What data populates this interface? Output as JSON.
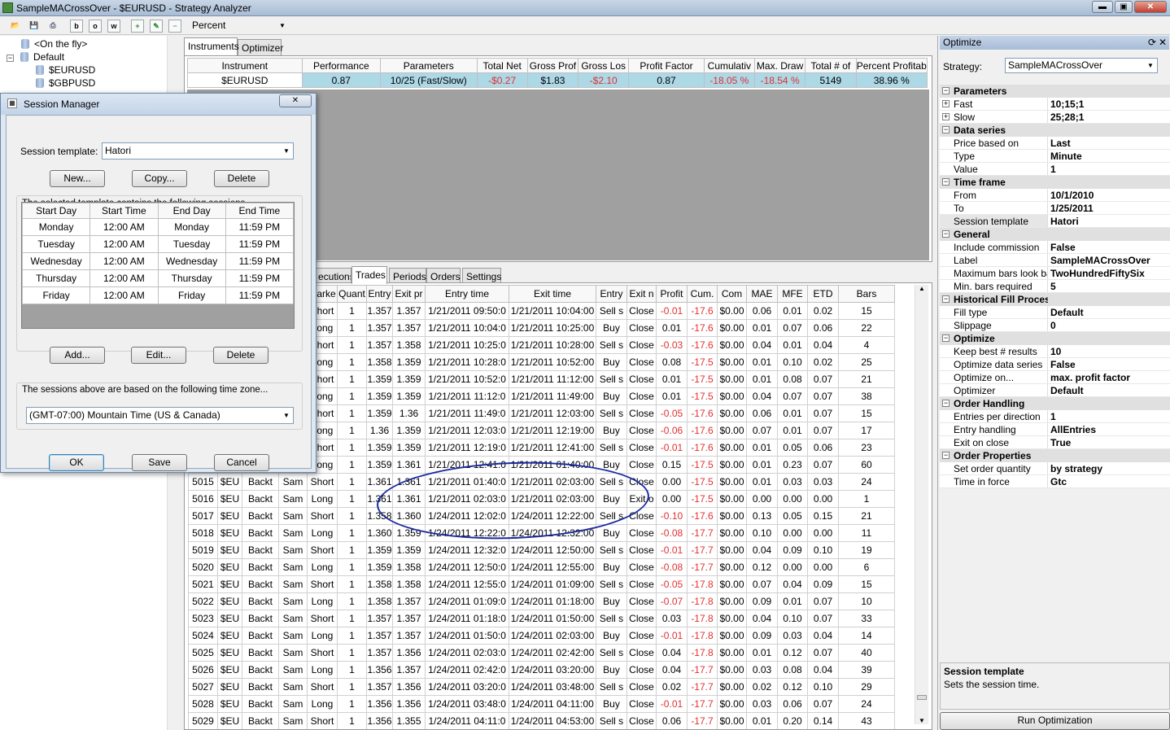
{
  "window": {
    "title": "SampleMACrossOver - $EURUSD - Strategy Analyzer"
  },
  "toolbar": {
    "view_value": "Percent",
    "b1": "b",
    "b2": "o",
    "b3": "w"
  },
  "tree": {
    "items": [
      "<On the fly>",
      "Default",
      "$EURUSD",
      "$GBPUSD"
    ]
  },
  "top_tabs": [
    "Instruments",
    "Optimizer"
  ],
  "instruments": {
    "headers": [
      "Instrument",
      "Performance",
      "Parameters",
      "Total Net",
      "Gross Prof",
      "Gross Los",
      "Profit Factor",
      "Cumulativ",
      "Max. Draw",
      "Total # of",
      "Percent Profitab"
    ],
    "row": [
      "$EURUSD",
      "0.87",
      "10/25 (Fast/Slow)",
      "-$0.27",
      "$1.83",
      "-$2.10",
      "0.87",
      "-18.05 %",
      "-18.54 %",
      "5149",
      "38.96 %"
    ]
  },
  "bottom_tabs": [
    "ecutions",
    "Trades",
    "Periods",
    "Orders",
    "Settings"
  ],
  "trades": {
    "headers": [
      "",
      "",
      "",
      "",
      "Marke",
      "Quant",
      "Entry",
      "Exit pr",
      "Entry time",
      "Exit time",
      "Entry",
      "Exit n",
      "Profit",
      "Cum.",
      "Com",
      "MAE",
      "MFE",
      "ETD",
      "Bars"
    ],
    "rows": [
      [
        "",
        "",
        "",
        "",
        "Short",
        "1",
        "1.357",
        "1.357",
        "1/21/2011 09:50:0",
        "1/21/2011 10:04:00",
        "Sell s",
        "Close",
        "-0.01",
        "-17.6",
        "$0.00",
        "0.06",
        "0.01",
        "0.02",
        "15"
      ],
      [
        "",
        "",
        "",
        "",
        "Long",
        "1",
        "1.357",
        "1.357",
        "1/21/2011 10:04:0",
        "1/21/2011 10:25:00",
        "Buy",
        "Close",
        "0.01",
        "-17.6",
        "$0.00",
        "0.01",
        "0.07",
        "0.06",
        "22"
      ],
      [
        "",
        "",
        "",
        "",
        "Short",
        "1",
        "1.357",
        "1.358",
        "1/21/2011 10:25:0",
        "1/21/2011 10:28:00",
        "Sell s",
        "Close",
        "-0.03",
        "-17.6",
        "$0.00",
        "0.04",
        "0.01",
        "0.04",
        "4"
      ],
      [
        "",
        "",
        "",
        "",
        "Long",
        "1",
        "1.358",
        "1.359",
        "1/21/2011 10:28:0",
        "1/21/2011 10:52:00",
        "Buy",
        "Close",
        "0.08",
        "-17.5",
        "$0.00",
        "0.01",
        "0.10",
        "0.02",
        "25"
      ],
      [
        "",
        "",
        "",
        "",
        "Short",
        "1",
        "1.359",
        "1.359",
        "1/21/2011 10:52:0",
        "1/21/2011 11:12:00",
        "Sell s",
        "Close",
        "0.01",
        "-17.5",
        "$0.00",
        "0.01",
        "0.08",
        "0.07",
        "21"
      ],
      [
        "",
        "",
        "",
        "",
        "Long",
        "1",
        "1.359",
        "1.359",
        "1/21/2011 11:12:0",
        "1/21/2011 11:49:00",
        "Buy",
        "Close",
        "0.01",
        "-17.5",
        "$0.00",
        "0.04",
        "0.07",
        "0.07",
        "38"
      ],
      [
        "",
        "",
        "",
        "",
        "Short",
        "1",
        "1.359",
        "1.36",
        "1/21/2011 11:49:0",
        "1/21/2011 12:03:00",
        "Sell s",
        "Close",
        "-0.05",
        "-17.6",
        "$0.00",
        "0.06",
        "0.01",
        "0.07",
        "15"
      ],
      [
        "",
        "",
        "",
        "",
        "Long",
        "1",
        "1.36",
        "1.359",
        "1/21/2011 12:03:0",
        "1/21/2011 12:19:00",
        "Buy",
        "Close",
        "-0.06",
        "-17.6",
        "$0.00",
        "0.07",
        "0.01",
        "0.07",
        "17"
      ],
      [
        "",
        "",
        "",
        "",
        "Short",
        "1",
        "1.359",
        "1.359",
        "1/21/2011 12:19:0",
        "1/21/2011 12:41:00",
        "Sell s",
        "Close",
        "-0.01",
        "-17.6",
        "$0.00",
        "0.01",
        "0.05",
        "0.06",
        "23"
      ],
      [
        "",
        "",
        "",
        "",
        "Long",
        "1",
        "1.359",
        "1.361",
        "1/21/2011 12:41:0",
        "1/21/2011 01:40:00",
        "Buy",
        "Close",
        "0.15",
        "-17.5",
        "$0.00",
        "0.01",
        "0.23",
        "0.07",
        "60"
      ],
      [
        "5015",
        "$EU",
        "Backt",
        "Sam",
        "Short",
        "1",
        "1.361",
        "1.361",
        "1/21/2011 01:40:0",
        "1/21/2011 02:03:00",
        "Sell s",
        "Close",
        "0.00",
        "-17.5",
        "$0.00",
        "0.01",
        "0.03",
        "0.03",
        "24"
      ],
      [
        "5016",
        "$EU",
        "Backt",
        "Sam",
        "Long",
        "1",
        "1.361",
        "1.361",
        "1/21/2011 02:03:0",
        "1/21/2011 02:03:00",
        "Buy",
        "Exit o",
        "0.00",
        "-17.5",
        "$0.00",
        "0.00",
        "0.00",
        "0.00",
        "1"
      ],
      [
        "5017",
        "$EU",
        "Backt",
        "Sam",
        "Short",
        "1",
        "1.358",
        "1.360",
        "1/24/2011 12:02:0",
        "1/24/2011 12:22:00",
        "Sell s",
        "Close",
        "-0.10",
        "-17.6",
        "$0.00",
        "0.13",
        "0.05",
        "0.15",
        "21"
      ],
      [
        "5018",
        "$EU",
        "Backt",
        "Sam",
        "Long",
        "1",
        "1.360",
        "1.359",
        "1/24/2011 12:22:0",
        "1/24/2011 12:32:00",
        "Buy",
        "Close",
        "-0.08",
        "-17.7",
        "$0.00",
        "0.10",
        "0.00",
        "0.00",
        "11"
      ],
      [
        "5019",
        "$EU",
        "Backt",
        "Sam",
        "Short",
        "1",
        "1.359",
        "1.359",
        "1/24/2011 12:32:0",
        "1/24/2011 12:50:00",
        "Sell s",
        "Close",
        "-0.01",
        "-17.7",
        "$0.00",
        "0.04",
        "0.09",
        "0.10",
        "19"
      ],
      [
        "5020",
        "$EU",
        "Backt",
        "Sam",
        "Long",
        "1",
        "1.359",
        "1.358",
        "1/24/2011 12:50:0",
        "1/24/2011 12:55:00",
        "Buy",
        "Close",
        "-0.08",
        "-17.7",
        "$0.00",
        "0.12",
        "0.00",
        "0.00",
        "6"
      ],
      [
        "5021",
        "$EU",
        "Backt",
        "Sam",
        "Short",
        "1",
        "1.358",
        "1.358",
        "1/24/2011 12:55:0",
        "1/24/2011 01:09:00",
        "Sell s",
        "Close",
        "-0.05",
        "-17.8",
        "$0.00",
        "0.07",
        "0.04",
        "0.09",
        "15"
      ],
      [
        "5022",
        "$EU",
        "Backt",
        "Sam",
        "Long",
        "1",
        "1.358",
        "1.357",
        "1/24/2011 01:09:0",
        "1/24/2011 01:18:00",
        "Buy",
        "Close",
        "-0.07",
        "-17.8",
        "$0.00",
        "0.09",
        "0.01",
        "0.07",
        "10"
      ],
      [
        "5023",
        "$EU",
        "Backt",
        "Sam",
        "Short",
        "1",
        "1.357",
        "1.357",
        "1/24/2011 01:18:0",
        "1/24/2011 01:50:00",
        "Sell s",
        "Close",
        "0.03",
        "-17.8",
        "$0.00",
        "0.04",
        "0.10",
        "0.07",
        "33"
      ],
      [
        "5024",
        "$EU",
        "Backt",
        "Sam",
        "Long",
        "1",
        "1.357",
        "1.357",
        "1/24/2011 01:50:0",
        "1/24/2011 02:03:00",
        "Buy",
        "Close",
        "-0.01",
        "-17.8",
        "$0.00",
        "0.09",
        "0.03",
        "0.04",
        "14"
      ],
      [
        "5025",
        "$EU",
        "Backt",
        "Sam",
        "Short",
        "1",
        "1.357",
        "1.356",
        "1/24/2011 02:03:0",
        "1/24/2011 02:42:00",
        "Sell s",
        "Close",
        "0.04",
        "-17.8",
        "$0.00",
        "0.01",
        "0.12",
        "0.07",
        "40"
      ],
      [
        "5026",
        "$EU",
        "Backt",
        "Sam",
        "Long",
        "1",
        "1.356",
        "1.357",
        "1/24/2011 02:42:0",
        "1/24/2011 03:20:00",
        "Buy",
        "Close",
        "0.04",
        "-17.7",
        "$0.00",
        "0.03",
        "0.08",
        "0.04",
        "39"
      ],
      [
        "5027",
        "$EU",
        "Backt",
        "Sam",
        "Short",
        "1",
        "1.357",
        "1.356",
        "1/24/2011 03:20:0",
        "1/24/2011 03:48:00",
        "Sell s",
        "Close",
        "0.02",
        "-17.7",
        "$0.00",
        "0.02",
        "0.12",
        "0.10",
        "29"
      ],
      [
        "5028",
        "$EU",
        "Backt",
        "Sam",
        "Long",
        "1",
        "1.356",
        "1.356",
        "1/24/2011 03:48:0",
        "1/24/2011 04:11:00",
        "Buy",
        "Close",
        "-0.01",
        "-17.7",
        "$0.00",
        "0.03",
        "0.06",
        "0.07",
        "24"
      ],
      [
        "5029",
        "$EU",
        "Backt",
        "Sam",
        "Short",
        "1",
        "1.356",
        "1.355",
        "1/24/2011 04:11:0",
        "1/24/2011 04:53:00",
        "Sell s",
        "Close",
        "0.06",
        "-17.7",
        "$0.00",
        "0.01",
        "0.20",
        "0.14",
        "43"
      ]
    ]
  },
  "optimize": {
    "title": "Optimize",
    "strategy_label": "Strategy:",
    "strategy_value": "SampleMACrossOver",
    "rows": [
      {
        "cat": "Parameters"
      },
      {
        "k": "Fast",
        "v": "10;15;1",
        "exp": "+"
      },
      {
        "k": "Slow",
        "v": "25;28;1",
        "exp": "+"
      },
      {
        "cat": "Data series"
      },
      {
        "k": "Price based on",
        "v": "Last"
      },
      {
        "k": "Type",
        "v": "Minute"
      },
      {
        "k": "Value",
        "v": "1"
      },
      {
        "cat": "Time frame"
      },
      {
        "k": "From",
        "v": "10/1/2010"
      },
      {
        "k": "To",
        "v": "1/25/2011"
      },
      {
        "k": "Session template",
        "v": "Hatori",
        "sel": true
      },
      {
        "cat": "General"
      },
      {
        "k": "Include commission",
        "v": "False"
      },
      {
        "k": "Label",
        "v": "SampleMACrossOver"
      },
      {
        "k": "Maximum bars look bac",
        "v": "TwoHundredFiftySix"
      },
      {
        "k": "Min. bars required",
        "v": "5"
      },
      {
        "cat": "Historical Fill Processing"
      },
      {
        "k": "Fill type",
        "v": "Default"
      },
      {
        "k": "Slippage",
        "v": "0"
      },
      {
        "cat": "Optimize"
      },
      {
        "k": "Keep best # results",
        "v": "10"
      },
      {
        "k": "Optimize data series",
        "v": "False"
      },
      {
        "k": "Optimize on...",
        "v": "max. profit factor"
      },
      {
        "k": "Optimizer",
        "v": "Default"
      },
      {
        "cat": "Order Handling"
      },
      {
        "k": "Entries per direction",
        "v": "1"
      },
      {
        "k": "Entry handling",
        "v": "AllEntries"
      },
      {
        "k": "Exit on close",
        "v": "True"
      },
      {
        "cat": "Order Properties"
      },
      {
        "k": "Set order quantity",
        "v": "by strategy"
      },
      {
        "k": "Time in force",
        "v": "Gtc"
      }
    ],
    "help_title": "Session template",
    "help_text": "Sets the session time.",
    "run_button": "Run Optimization"
  },
  "session_manager": {
    "title": "Session Manager",
    "template_label": "Session template:",
    "template_value": "Hatori",
    "new_btn": "New...",
    "copy_btn": "Copy...",
    "delete_btn": "Delete",
    "sessions_label": "The selected template contains the following sessions...",
    "headers": [
      "Start Day",
      "Start Time",
      "End Day",
      "End Time"
    ],
    "rows": [
      [
        "Monday",
        "12:00 AM",
        "Monday",
        "11:59 PM"
      ],
      [
        "Tuesday",
        "12:00 AM",
        "Tuesday",
        "11:59 PM"
      ],
      [
        "Wednesday",
        "12:00 AM",
        "Wednesday",
        "11:59 PM"
      ],
      [
        "Thursday",
        "12:00 AM",
        "Thursday",
        "11:59 PM"
      ],
      [
        "Friday",
        "12:00 AM",
        "Friday",
        "11:59 PM"
      ]
    ],
    "add_btn": "Add...",
    "edit_btn": "Edit...",
    "delete2_btn": "Delete",
    "tz_label": "The sessions above are based on the following time zone...",
    "tz_value": "(GMT-07:00) Mountain Time (US & Canada)",
    "ok_btn": "OK",
    "save_btn": "Save",
    "cancel_btn": "Cancel"
  }
}
